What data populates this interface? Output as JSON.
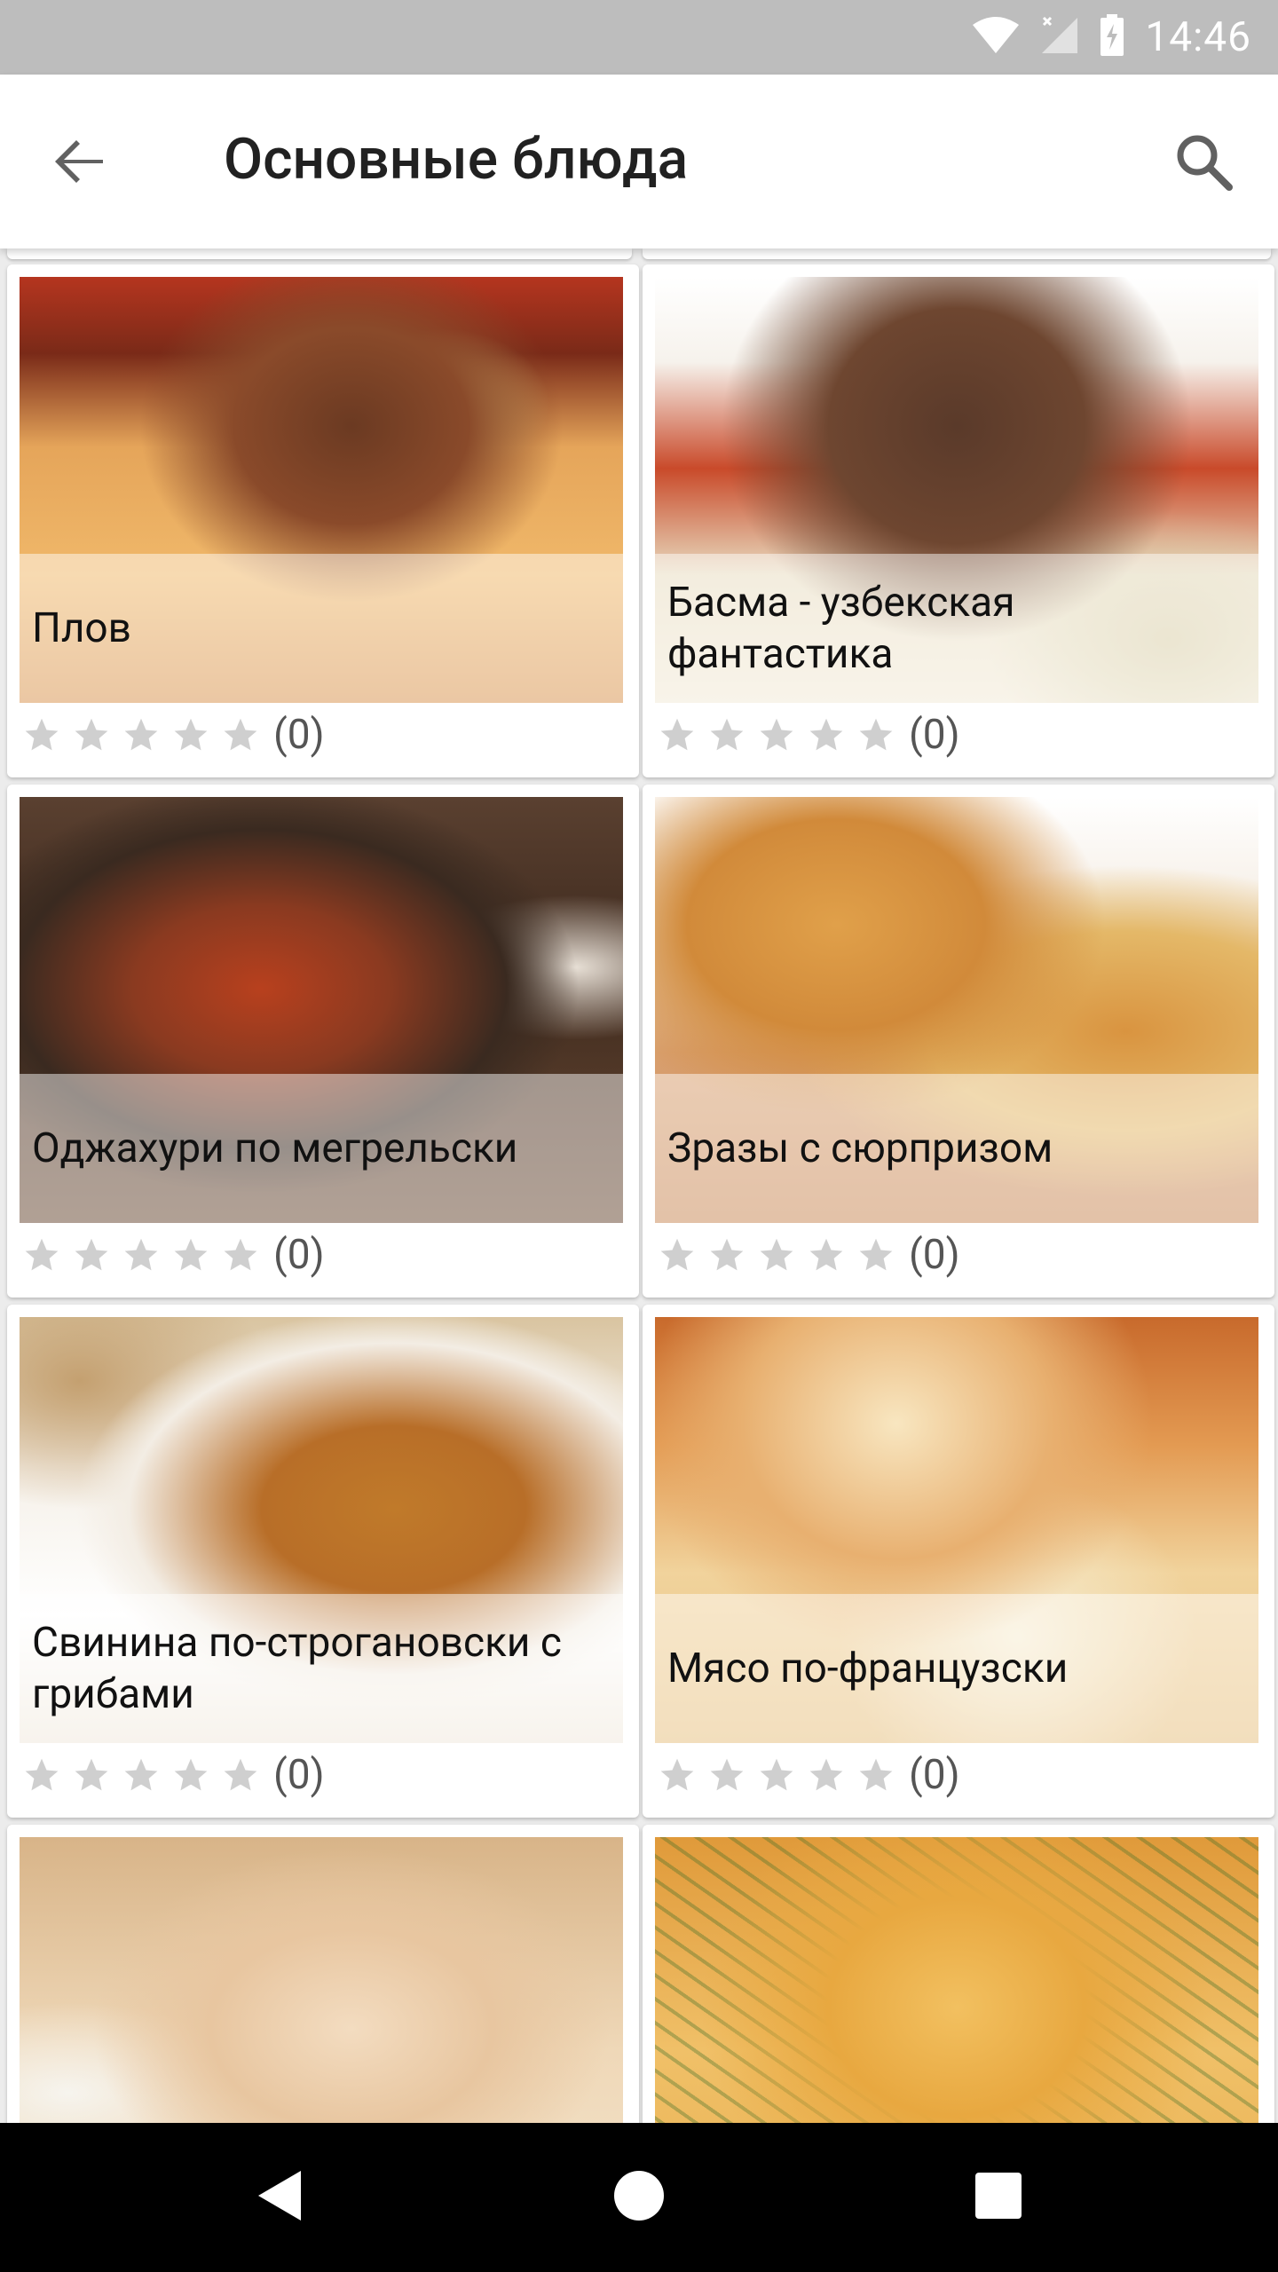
{
  "status_bar": {
    "time": "14:46"
  },
  "app_bar": {
    "title": "Основные блюда"
  },
  "recipes": [
    {
      "title": "Плов",
      "rating_count": "(0)"
    },
    {
      "title": "Басма - узбекская фантастика",
      "rating_count": "(0)"
    },
    {
      "title": "Оджахури по мегрельски",
      "rating_count": "(0)"
    },
    {
      "title": "Зразы с сюрпризом",
      "rating_count": "(0)"
    },
    {
      "title": "Свинина по-строгановски с грибами",
      "rating_count": "(0)"
    },
    {
      "title": "Мясо по-французски",
      "rating_count": "(0)"
    },
    {
      "title": "",
      "rating_count": ""
    },
    {
      "title": "",
      "rating_count": ""
    }
  ],
  "icons": {
    "back": "arrow-back-icon",
    "search": "search-icon",
    "star": "star-icon",
    "wifi": "wifi-icon",
    "signal": "signal-icon",
    "battery": "battery-icon",
    "nav_back": "nav-back-icon",
    "nav_home": "nav-home-icon",
    "nav_recents": "nav-recents-icon"
  },
  "colors": {
    "status_bar": "#bdbdbd",
    "app_bar": "#ffffff",
    "background": "#ececec",
    "star_empty": "#cfcfcf",
    "nav_bar": "#000000"
  }
}
